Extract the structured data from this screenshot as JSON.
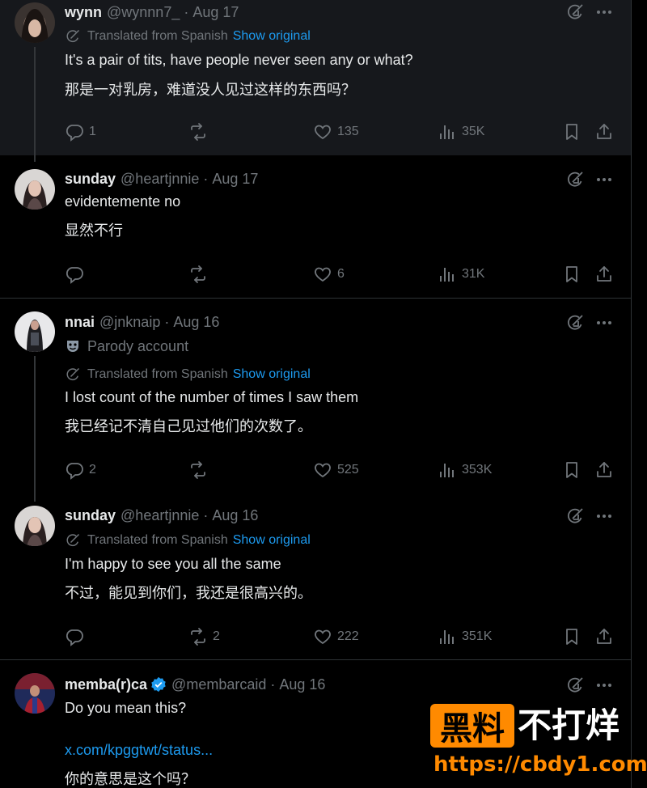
{
  "tweets": [
    {
      "name": "wynn",
      "handle": "@wynnn7_",
      "date": "Aug 17",
      "translated_label": "Translated from Spanish",
      "show_original": "Show original",
      "text_en": "It's a pair of tits, have people never seen any or what?",
      "text_zh": "那是一对乳房，难道没人见过这样的东西吗？",
      "replies": "1",
      "retweets": "",
      "likes": "135",
      "views": "35K"
    },
    {
      "name": "sunday",
      "handle": "@heartjnnie",
      "date": "Aug 17",
      "text_en": "evidentemente no",
      "text_zh": "显然不行",
      "replies": "",
      "retweets": "",
      "likes": "6",
      "views": "31K"
    },
    {
      "name": "nnai",
      "handle": "@jnknaip",
      "date": "Aug 16",
      "parody_label": "Parody account",
      "translated_label": "Translated from Spanish",
      "show_original": "Show original",
      "text_en": "I lost count of the number of times I saw them",
      "text_zh": "我已经记不清自己见过他们的次数了。",
      "replies": "2",
      "retweets": "",
      "likes": "525",
      "views": "353K"
    },
    {
      "name": "sunday",
      "handle": "@heartjnnie",
      "date": "Aug 16",
      "translated_label": "Translated from Spanish",
      "show_original": "Show original",
      "text_en": "I'm happy to see you all the same",
      "text_zh": "不过，能见到你们，我还是很高兴的。",
      "replies": "",
      "retweets": "2",
      "likes": "222",
      "views": "351K"
    },
    {
      "name": "memba(r)ca",
      "handle": "@membarcaid",
      "date": "Aug 16",
      "text_en": "Do you mean this?",
      "link": "x.com/kpggtwt/status...",
      "text_zh": "你的意思是这个吗？"
    }
  ],
  "separator": "·",
  "watermark": {
    "box": "黑料",
    "right": "不打烊",
    "url": "https://cbdy1.com"
  },
  "colors": {
    "background": "#000000",
    "highlight": "#16181c",
    "muted": "#71767b",
    "link": "#1d9bf0",
    "watermark": "#ff8a00"
  }
}
